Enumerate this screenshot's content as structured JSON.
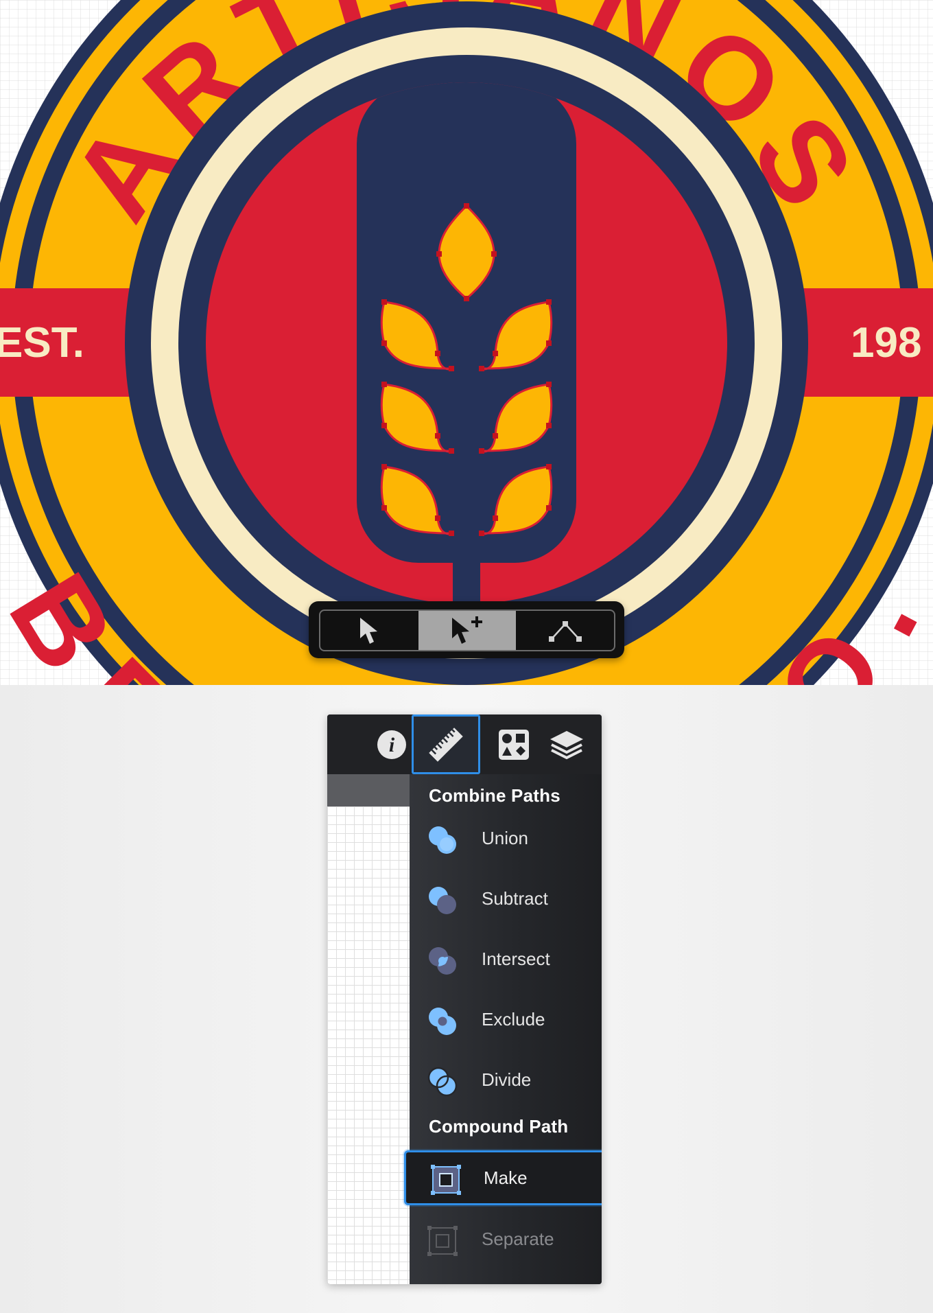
{
  "canvas": {
    "badge_text_top": "ARTISANOS",
    "badge_text_bottom": "BREWING CO.",
    "est_label": "EST.",
    "year_label": "198",
    "colors": {
      "yellow": "#FDB604",
      "navy": "#253259",
      "red": "#DA1F34",
      "cream": "#F8EBC3"
    }
  },
  "toolbar": {
    "tools": [
      {
        "icon": "arrow-pointer-icon",
        "active": false
      },
      {
        "icon": "arrow-pointer-plus-icon",
        "active": true
      },
      {
        "icon": "node-path-icon",
        "active": false
      }
    ]
  },
  "panel": {
    "tabs": [
      {
        "icon": "info-icon",
        "selected": false
      },
      {
        "icon": "ruler-icon",
        "selected": true
      },
      {
        "icon": "shapes-icon",
        "selected": false
      },
      {
        "icon": "layers-icon",
        "selected": false
      }
    ],
    "combine_title": "Combine Paths",
    "combine_items": [
      {
        "label": "Union",
        "icon": "union-icon"
      },
      {
        "label": "Subtract",
        "icon": "subtract-icon"
      },
      {
        "label": "Intersect",
        "icon": "intersect-icon"
      },
      {
        "label": "Exclude",
        "icon": "exclude-icon"
      },
      {
        "label": "Divide",
        "icon": "divide-icon"
      }
    ],
    "compound_title": "Compound Path",
    "compound_items": [
      {
        "label": "Make",
        "icon": "compound-make-icon",
        "highlighted": true
      },
      {
        "label": "Separate",
        "icon": "compound-separate-icon",
        "disabled": true
      }
    ],
    "accent_color": "#2F8EE8"
  }
}
